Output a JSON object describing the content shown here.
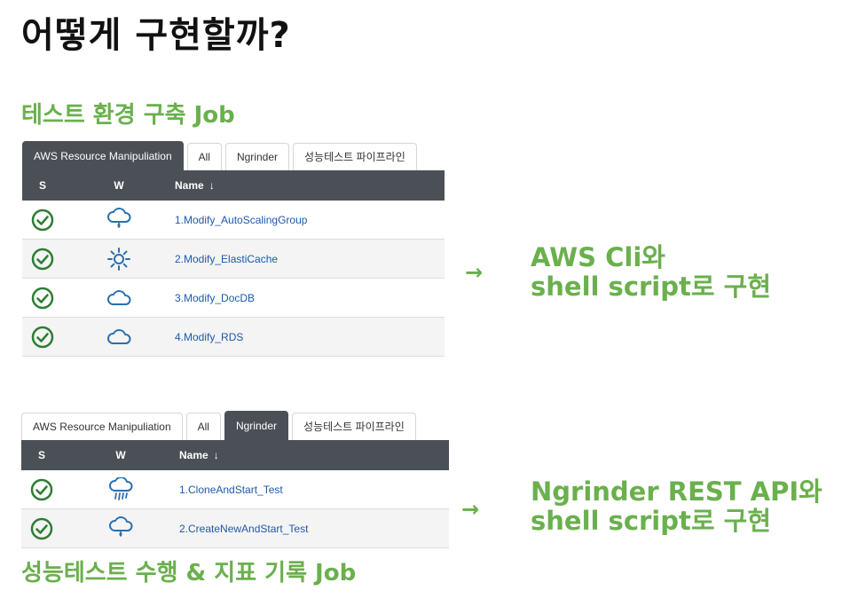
{
  "page": {
    "title": "어떻게 구현할까?",
    "section1_title": "테스트 환경 구축 Job",
    "section2_title": "성능테스트 수행 & 지표 기록 Job",
    "arrow_symbol": "→",
    "note1_line1": "AWS Cli와",
    "note1_line2": "shell script로 구현",
    "note2_line1": "Ngrinder REST API와",
    "note2_line2": "shell script로 구현"
  },
  "panel1": {
    "tabs": [
      {
        "label": "AWS Resource Manipuliation",
        "active": true
      },
      {
        "label": "All",
        "active": false
      },
      {
        "label": "Ngrinder",
        "active": false
      },
      {
        "label": "성능테스트 파이프라인",
        "active": false
      }
    ],
    "headers": {
      "s": "S",
      "w": "W",
      "name": "Name",
      "sort_arrow": "↓"
    },
    "rows": [
      {
        "name": "1.Modify_AutoScalingGroup",
        "status_icon": "success-check-icon",
        "weather_icon": "cloud-rain-icon"
      },
      {
        "name": "2.Modify_ElastiCache",
        "status_icon": "success-check-icon",
        "weather_icon": "sun-icon"
      },
      {
        "name": "3.Modify_DocDB",
        "status_icon": "success-check-icon",
        "weather_icon": "cloud-icon"
      },
      {
        "name": "4.Modify_RDS",
        "status_icon": "success-check-icon",
        "weather_icon": "cloud-icon"
      }
    ]
  },
  "panel2": {
    "tabs": [
      {
        "label": "AWS Resource Manipuliation",
        "active": false
      },
      {
        "label": "All",
        "active": false
      },
      {
        "label": "Ngrinder",
        "active": true
      },
      {
        "label": "성능테스트 파이프라인",
        "active": false
      }
    ],
    "headers": {
      "s": "S",
      "w": "W",
      "name": "Name",
      "sort_arrow": "↓"
    },
    "rows": [
      {
        "name": "1.CloneAndStart_Test",
        "status_icon": "success-check-icon",
        "weather_icon": "storm-cloud-icon"
      },
      {
        "name": "2.CreateNewAndStart_Test",
        "status_icon": "success-check-icon",
        "weather_icon": "cloud-rain-icon"
      }
    ]
  },
  "colors": {
    "accent_green": "#6ab04c",
    "table_header_bg": "#4a5056",
    "status_green": "#2e7d32",
    "link_blue": "#1d5aa8",
    "weather_blue": "#2a6fb0"
  }
}
